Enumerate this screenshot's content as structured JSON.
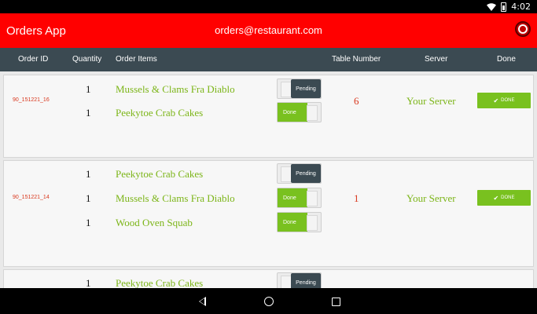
{
  "status": {
    "time": "4:02"
  },
  "appbar": {
    "title": "Orders App",
    "email": "orders@restaurant.com"
  },
  "columns": {
    "order_id": "Order ID",
    "quantity": "Quantity",
    "order_items": "Order Items",
    "table_number": "Table Number",
    "server": "Server",
    "done": "Done"
  },
  "orders": [
    {
      "id": "90_151221_16",
      "table": "6",
      "server": "Your Server",
      "done_label": "DONE",
      "items": [
        {
          "qty": "1",
          "name": "Mussels & Clams Fra Diablo",
          "status": "Pending"
        },
        {
          "qty": "1",
          "name": "Peekytoe Crab Cakes",
          "status": "Done"
        }
      ]
    },
    {
      "id": "90_151221_14",
      "table": "1",
      "server": "Your Server",
      "done_label": "DONE",
      "items": [
        {
          "qty": "1",
          "name": "Peekytoe Crab Cakes",
          "status": "Pending"
        },
        {
          "qty": "1",
          "name": "Mussels & Clams Fra Diablo",
          "status": "Done"
        },
        {
          "qty": "1",
          "name": "Wood Oven Squab",
          "status": "Done"
        }
      ]
    },
    {
      "items": [
        {
          "qty": "1",
          "name": "Peekytoe Crab Cakes",
          "status": "Pending"
        }
      ]
    }
  ],
  "colors": {
    "appbar": "#ff0000",
    "header": "#3b4a52",
    "accent_green": "#79c11f",
    "item_text": "#7cb518",
    "id_text": "#d9381e"
  },
  "icons": {
    "wifi": "wifi-icon",
    "battery": "battery-icon",
    "action": "record-icon",
    "check": "check-icon"
  }
}
